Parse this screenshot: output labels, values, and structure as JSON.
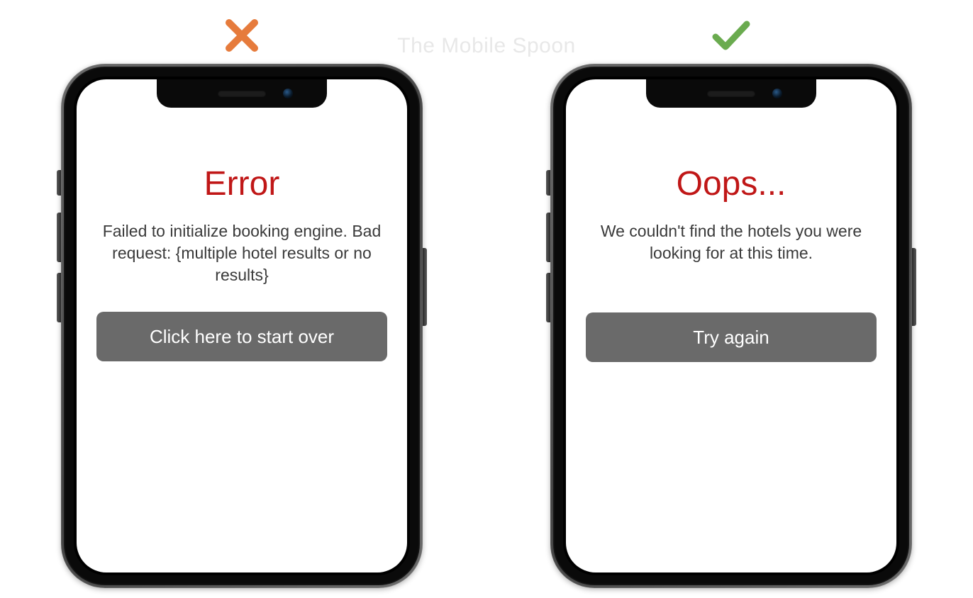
{
  "watermark": "The Mobile Spoon",
  "bad_example": {
    "title": "Error",
    "message": "Failed to initialize booking engine. Bad request: {multiple hotel results or no results}",
    "button_label": "Click here to start over"
  },
  "good_example": {
    "title": "Oops...",
    "message": "We couldn't find the hotels you were looking for at this time.",
    "button_label": "Try again"
  },
  "colors": {
    "bad_indicator": "#e67b3c",
    "good_indicator": "#6aab4f",
    "title_color": "#c01717",
    "button_bg": "#6a6a6a"
  }
}
